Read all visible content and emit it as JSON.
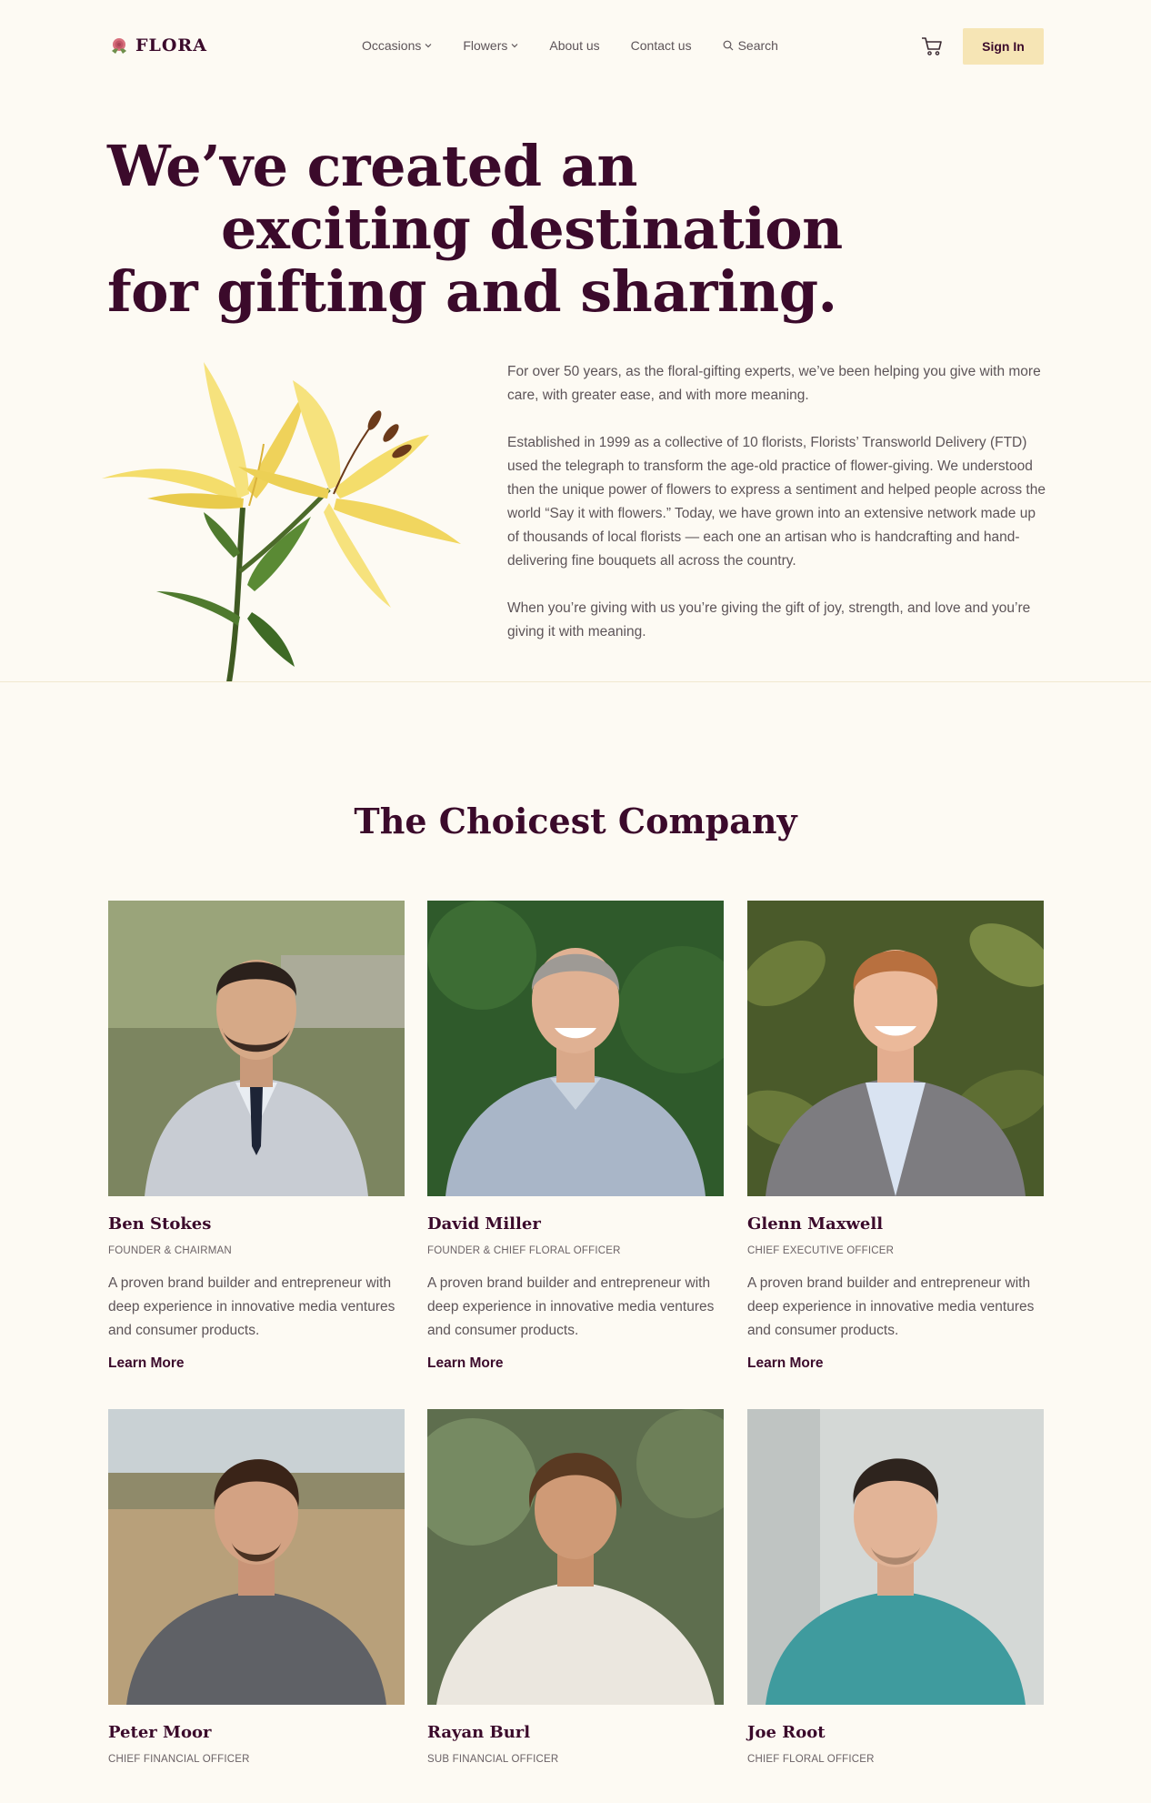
{
  "nav": {
    "logo": "FLORA",
    "items": [
      {
        "label": "Occasions",
        "dropdown": true
      },
      {
        "label": "Flowers",
        "dropdown": true
      },
      {
        "label": "About us",
        "dropdown": false
      },
      {
        "label": "Contact us",
        "dropdown": false
      }
    ],
    "search_label": "Search",
    "signin_label": "Sign In"
  },
  "hero": {
    "title_lines": [
      "We’ve created an",
      "exciting destination",
      "for gifting and sharing."
    ],
    "paragraphs": [
      "For over 50 years, as the floral-gifting experts, we’ve been helping you give with more care, with greater ease, and with more meaning.",
      "Established in 1999 as a collective of 10 florists, Florists’ Transworld Delivery (FTD) used the telegraph to transform the age-old practice of flower-giving. We understood then the unique power of flowers to express a sentiment and helped people across the world “Say it with flowers.” Today, we have grown into an extensive network made up of thousands of local florists — each one an artisan who is handcrafting and hand-delivering fine bouquets all across the country.",
      "When you’re giving with us you’re giving the gift of joy, strength, and love and you’re giving it with meaning."
    ]
  },
  "team": {
    "title": "The Choicest Company",
    "learn_more_label": "Learn More",
    "members": [
      {
        "name": "Ben Stokes",
        "role": "Founder & Chairman",
        "bio": "A proven brand builder and entrepreneur with deep experience in innovative media ventures and consumer products."
      },
      {
        "name": "David Miller",
        "role": "Founder & Chief Floral Officer",
        "bio": "A proven brand builder and entrepreneur with deep experience in innovative media ventures and consumer products."
      },
      {
        "name": "Glenn Maxwell",
        "role": "Chief Executive Officer",
        "bio": "A proven brand builder and entrepreneur with deep experience in innovative media ventures and consumer products."
      },
      {
        "name": "Peter Moor",
        "role": "Chief Financial Officer"
      },
      {
        "name": "Rayan Burl",
        "role": "Sub Financial Officer"
      },
      {
        "name": "Joe Root",
        "role": "Chief Floral Officer"
      }
    ]
  },
  "colors": {
    "background": "#fdfaf3",
    "brand": "#3b0a2b",
    "accent": "#f6e5b5",
    "text": "#5d5458"
  }
}
